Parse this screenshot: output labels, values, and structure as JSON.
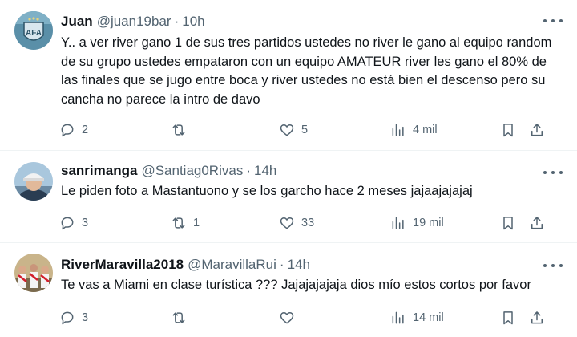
{
  "tweets": [
    {
      "name": "Juan",
      "handle": "@juan19bar",
      "time": "10h",
      "text": "Y.. a ver river gano 1 de sus tres partidos ustedes no river le gano al equipo random de su grupo ustedes empataron con un equipo AMATEUR river les gano el 80% de las finales que se jugo entre boca y river ustedes no está bien el descenso pero su cancha no parece la intro de davo",
      "replies": "2",
      "retweets": "",
      "likes": "5",
      "views": "4 mil",
      "avatar_icon": "afa-badge-icon"
    },
    {
      "name": "sanrimanga",
      "handle": "@Santiag0Rivas",
      "time": "14h",
      "text": "Le piden foto a Mastantuono y se los garcho hace 2 meses jajaajajajaj",
      "replies": "3",
      "retweets": "1",
      "likes": "33",
      "views": "19 mil",
      "avatar_icon": "person-photo-icon"
    },
    {
      "name": "RiverMaravilla2018",
      "handle": "@MaravillaRui",
      "time": "14h",
      "text": "Te vas a Miami en clase turística ??? Jajajajajaja dios mío estos cortos por favor",
      "replies": "3",
      "retweets": "",
      "likes": "",
      "views": "14 mil",
      "avatar_icon": "team-photo-icon"
    }
  ],
  "separator": "·"
}
